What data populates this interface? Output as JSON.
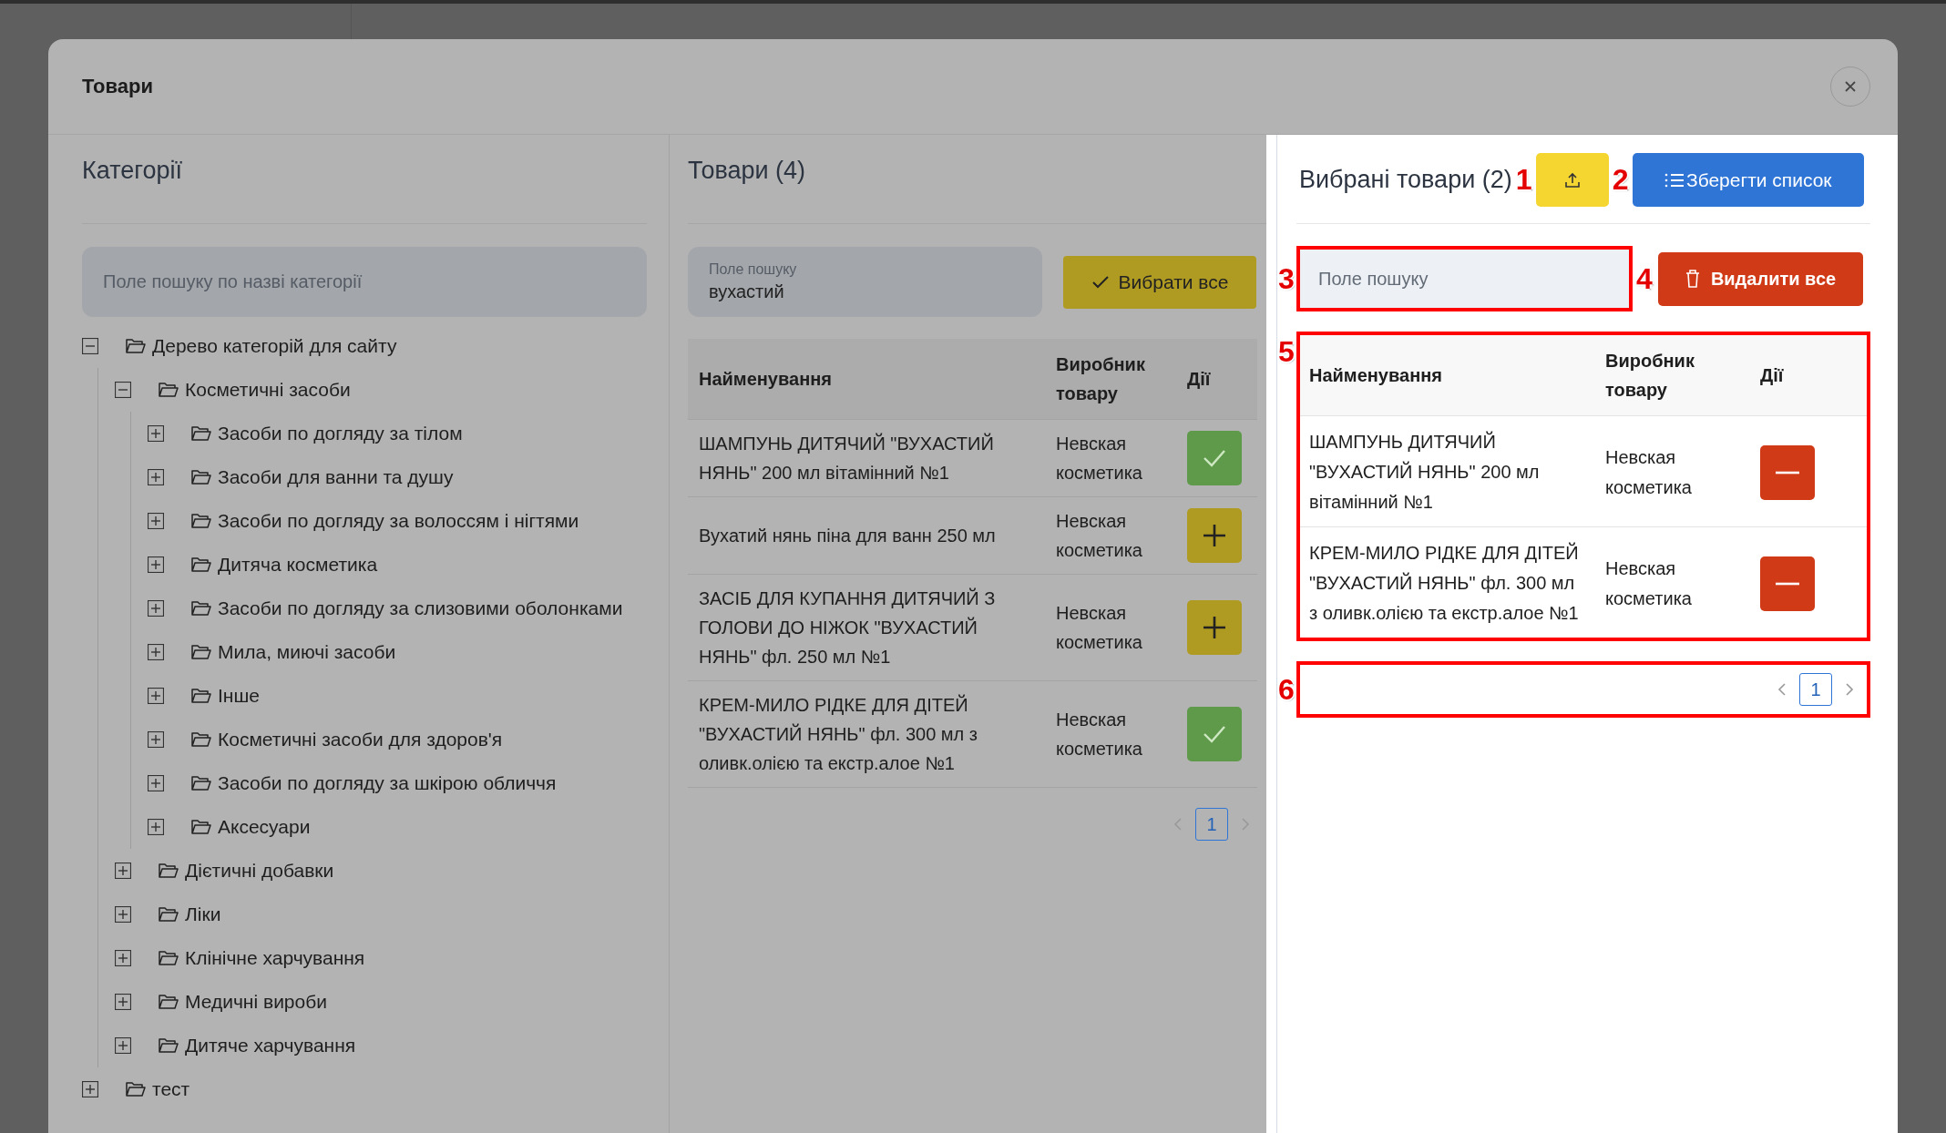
{
  "dialog": {
    "title": "Товари"
  },
  "categories": {
    "title": "Категорії",
    "search": {
      "placeholder": "Поле пошуку по назві категорії"
    },
    "tree": [
      {
        "label": "Дерево категорій для сайту",
        "expanded": true,
        "children": [
          {
            "label": "Косметичні засоби",
            "expanded": true,
            "children": [
              {
                "label": "Засоби по догляду за тілом",
                "expanded": false
              },
              {
                "label": "Засоби для ванни та душу",
                "expanded": false
              },
              {
                "label": "Засоби по догляду за волоссям і нігтями",
                "expanded": false
              },
              {
                "label": "Дитяча косметика",
                "expanded": false
              },
              {
                "label": "Засоби по догляду за слизовими оболонками",
                "expanded": false
              },
              {
                "label": "Мила, миючі засоби",
                "expanded": false
              },
              {
                "label": "Інше",
                "expanded": false
              },
              {
                "label": "Косметичні засоби для здоров'я",
                "expanded": false
              },
              {
                "label": "Засоби по догляду за шкірою обличчя",
                "expanded": false
              },
              {
                "label": "Аксесуари",
                "expanded": false
              }
            ]
          },
          {
            "label": "Дієтичні добавки",
            "expanded": false
          },
          {
            "label": "Ліки",
            "expanded": false
          },
          {
            "label": "Клінічне харчування",
            "expanded": false
          },
          {
            "label": "Медичні вироби",
            "expanded": false
          },
          {
            "label": "Дитяче харчування",
            "expanded": false
          }
        ]
      },
      {
        "label": "тест",
        "expanded": false
      }
    ]
  },
  "products": {
    "title": "Товари (4)",
    "search": {
      "label": "Поле пошуку",
      "value": "вухастий"
    },
    "select_all_button": "Вибрати все",
    "columns": [
      "Найменування",
      "Виробник товару",
      "Дії"
    ],
    "rows": [
      {
        "name": "ШАМПУНЬ ДИТЯЧИЙ \"ВУХАСТИЙ НЯНЬ\" 200 мл вітамінний №1",
        "manufacturer": "Невская косметика",
        "selected": true
      },
      {
        "name": "Вухатий нянь піна для ванн 250 мл",
        "manufacturer": "Невская косметика",
        "selected": false
      },
      {
        "name": "ЗАСІБ ДЛЯ КУПАННЯ ДИТЯЧИЙ З ГОЛОВИ ДО НІЖОК \"ВУХАСТИЙ НЯНЬ\" фл. 250 мл №1",
        "manufacturer": "Невская косметика",
        "selected": false
      },
      {
        "name": "КРЕМ-МИЛО РІДКЕ ДЛЯ ДІТЕЙ \"ВУХАСТИЙ НЯНЬ\" фл. 300 мл з оливк.олією та екстр.алое №1",
        "manufacturer": "Невская косметика",
        "selected": true
      }
    ],
    "pagination": {
      "pages": [
        {
          "label": "1",
          "selected": true
        }
      ]
    }
  },
  "selected_products": {
    "title": "Вибрані товари (2)",
    "export_button": {
      "callout": "1"
    },
    "save_button": {
      "label": "Зберегти список",
      "callout": "2"
    },
    "search": {
      "placeholder": "Поле пошуку",
      "callout": "3"
    },
    "delete_all_button": {
      "label": "Видалити все",
      "callout": "4"
    },
    "table": {
      "callout": "5",
      "columns": [
        "Найменування",
        "Виробник товару",
        "Дії"
      ],
      "rows": [
        {
          "name": "ШАМПУНЬ ДИТЯЧИЙ \"ВУХАСТИЙ НЯНЬ\" 200 мл вітамінний №1",
          "manufacturer": "Невская косметика"
        },
        {
          "name": "КРЕМ-МИЛО РІДКЕ ДЛЯ ДІТЕЙ \"ВУХАСТИЙ НЯНЬ\" фл. 300 мл з оливк.олією та екстр.алое №1",
          "manufacturer": "Невская косметика"
        }
      ]
    },
    "pagination": {
      "callout": "6",
      "pages": [
        {
          "label": "1",
          "selected": true
        }
      ]
    }
  }
}
